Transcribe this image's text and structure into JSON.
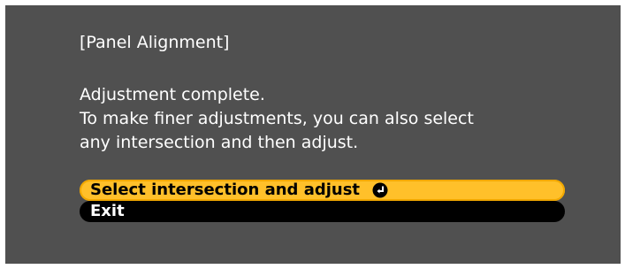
{
  "dialog": {
    "title": "[Panel Alignment]",
    "message_lines": [
      "Adjustment complete.",
      "To make finer adjustments, you can also select",
      "any intersection and then adjust."
    ]
  },
  "menu": {
    "items": [
      {
        "label": "Select intersection and adjust",
        "selected": true,
        "icon": "enter-icon"
      },
      {
        "label": "Exit",
        "selected": false
      }
    ]
  },
  "colors": {
    "background": "#505050",
    "selected_item": "#ffc02a",
    "item": "#000000",
    "text": "#ffffff"
  }
}
